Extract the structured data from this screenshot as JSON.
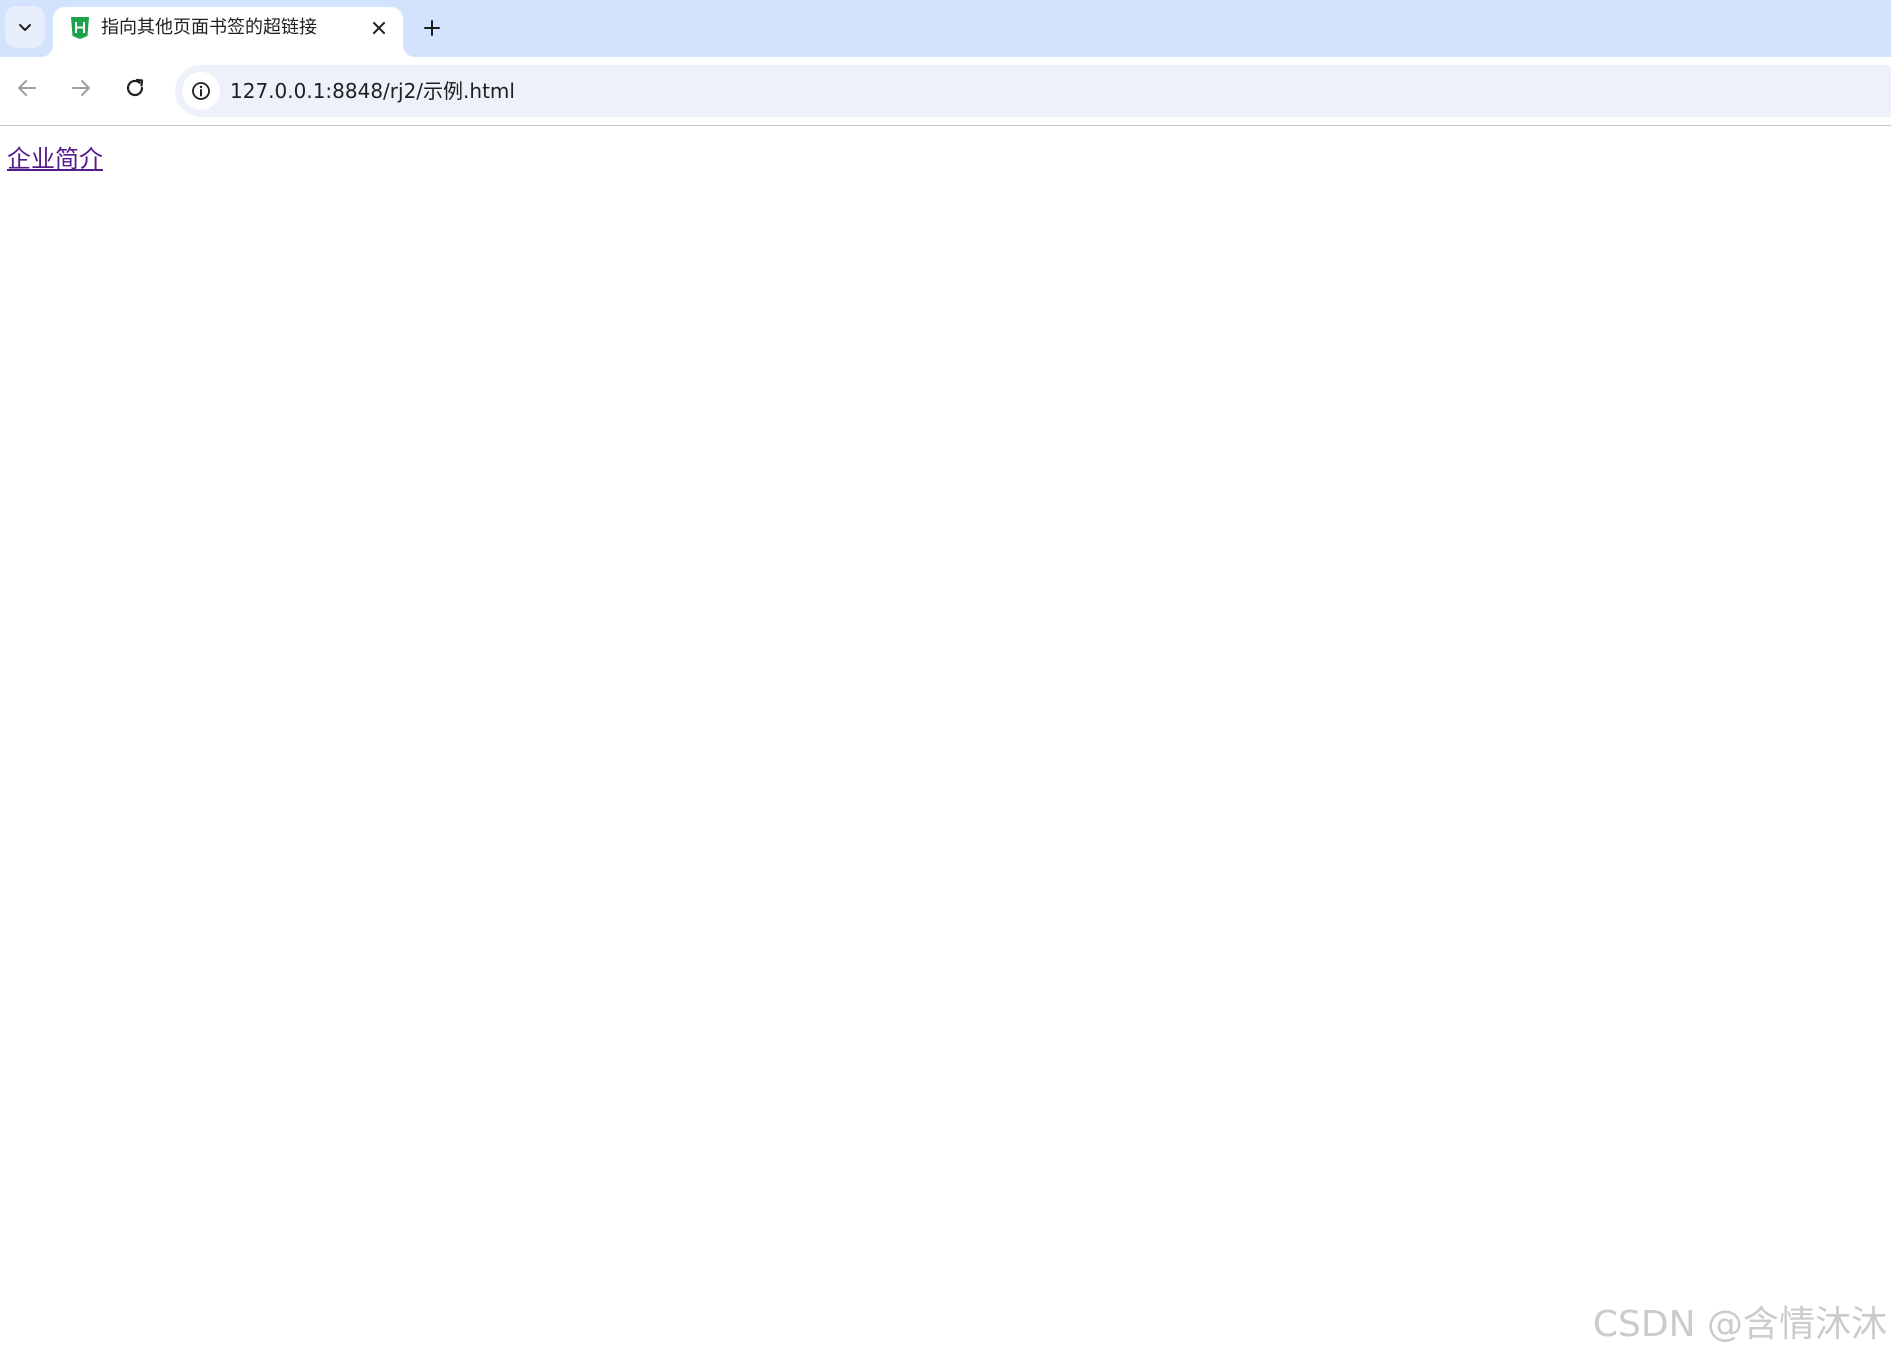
{
  "browser": {
    "tab": {
      "title": "指向其他页面书签的超链接",
      "favicon": "hbuilder-html-icon"
    },
    "address_bar": {
      "url": "127.0.0.1:8848/rj2/示例.html"
    }
  },
  "page": {
    "link_text": "企业简介",
    "link_color": "#551a8b"
  },
  "watermark": {
    "text": "CSDN @含情沐沐"
  },
  "colors": {
    "tabstrip": "#d3e3fd",
    "omnibox": "#edf2fa",
    "favicon": "#1aa34a"
  }
}
